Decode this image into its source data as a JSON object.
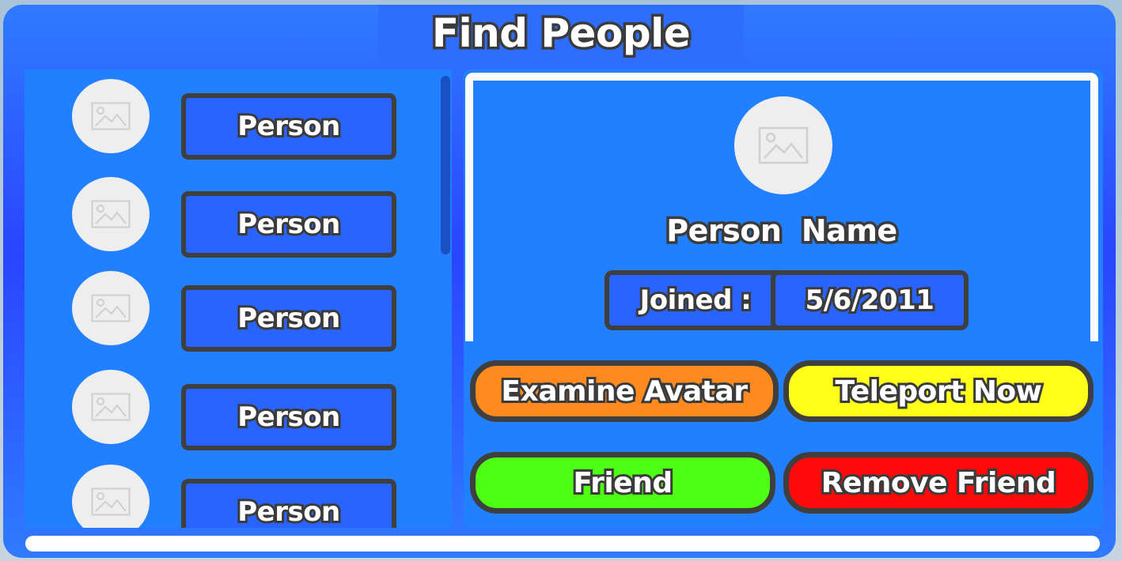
{
  "window": {
    "title": "Find People"
  },
  "list": {
    "items": [
      {
        "label": "Person",
        "avatar_icon": "image-placeholder-icon"
      },
      {
        "label": "Person",
        "avatar_icon": "image-placeholder-icon"
      },
      {
        "label": "Person",
        "avatar_icon": "image-placeholder-icon"
      },
      {
        "label": "Person",
        "avatar_icon": "image-placeholder-icon"
      },
      {
        "label": "Person",
        "avatar_icon": "image-placeholder-icon"
      }
    ]
  },
  "detail": {
    "avatar_icon": "image-placeholder-icon",
    "name": "Person  Name",
    "joined_label": "Joined :",
    "joined_date": "5/6/2011"
  },
  "actions": {
    "examine": {
      "label": "Examine Avatar",
      "color": "#ff8a1f"
    },
    "teleport": {
      "label": "Teleport Now",
      "color": "#ffff1a"
    },
    "friend": {
      "label": "Friend",
      "color": "#4dff12"
    },
    "remove": {
      "label": "Remove Friend",
      "color": "#ff0a0a"
    }
  },
  "colors": {
    "frame": "#2f6dff",
    "panel": "#2280ff",
    "name_box": "#2a64ff",
    "outline": "#3f3f3f",
    "avatar_bg": "#eeeeee"
  }
}
